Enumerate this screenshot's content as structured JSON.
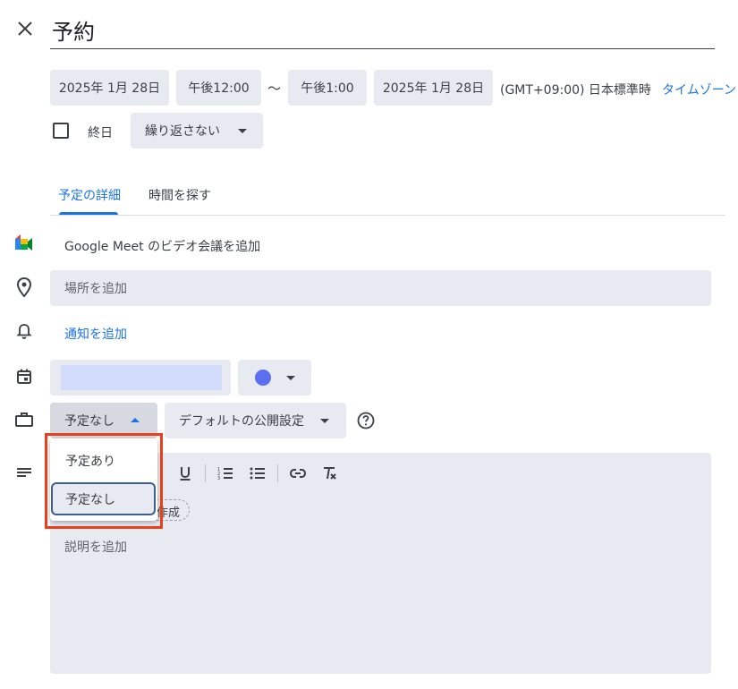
{
  "header": {
    "title": "予約"
  },
  "datetime": {
    "start_date": "2025年 1月 28日",
    "start_time": "午後12:00",
    "separator": "〜",
    "end_time": "午後1:00",
    "end_date": "2025年 1月 28日",
    "timezone_text": "(GMT+09:00) 日本標準時",
    "timezone_link": "タイムゾーン"
  },
  "allday": {
    "label": "終日",
    "checked": false
  },
  "repeat": {
    "value": "繰り返さない"
  },
  "tabs": [
    {
      "label": "予定の詳細",
      "active": true
    },
    {
      "label": "時間を探す",
      "active": false
    }
  ],
  "meet": {
    "label": "Google Meet のビデオ会議を追加"
  },
  "location": {
    "placeholder": "場所を追加"
  },
  "notification": {
    "label": "通知を追加"
  },
  "calendar": {
    "color": "#5c6ff0"
  },
  "availability": {
    "value": "予定なし",
    "options": [
      "予定あり",
      "予定なし"
    ],
    "selected_index": 1
  },
  "visibility": {
    "value": "デフォルトの公開設定"
  },
  "description": {
    "placeholder": "説明を追加",
    "chip_partial": "作成"
  },
  "colors": {
    "accent": "#1a73e8",
    "field_bg": "#e8eaf1",
    "highlight": "#e8401c",
    "calendar_dot": "#5c6ff0"
  }
}
